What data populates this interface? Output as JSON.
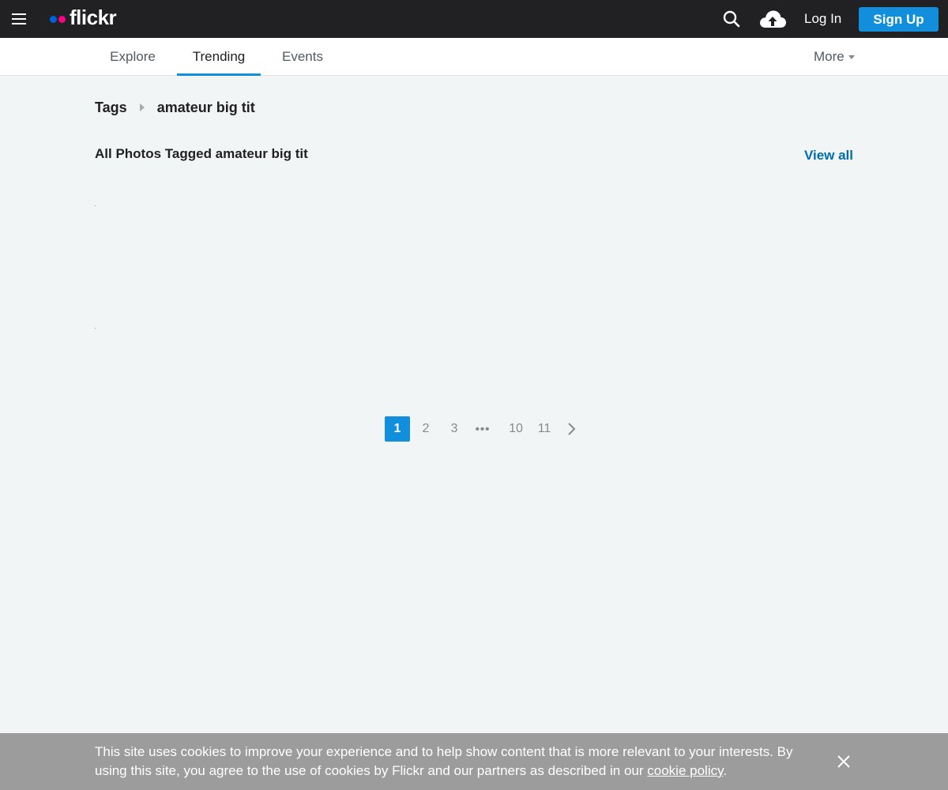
{
  "header": {
    "logo_text": "flickr",
    "logo_colors": {
      "blue": "#0063dc",
      "pink": "#ff0084"
    },
    "login_label": "Log In",
    "signup_label": "Sign Up",
    "icons": [
      "menu-icon",
      "search-icon",
      "upload-cloud-icon"
    ]
  },
  "subnav": {
    "tabs": [
      {
        "label": "Explore",
        "active": false
      },
      {
        "label": "Trending",
        "active": true
      },
      {
        "label": "Events",
        "active": false
      }
    ],
    "more_label": "More"
  },
  "breadcrumb": {
    "root": "Tags",
    "current": "amateur big tit"
  },
  "section": {
    "title": "All Photos Tagged amateur big tit",
    "view_all_label": "View all"
  },
  "pagination": {
    "pages": [
      "1",
      "2",
      "3"
    ],
    "ellipsis": "•••",
    "tail_pages": [
      "10",
      "11"
    ],
    "current": "1"
  },
  "cookie_banner": {
    "text_before": "This site uses cookies to improve your experience and to help show content that is more relevant to your interests. By using this site, you agree to the use of cookies by Flickr and our partners as described in our ",
    "link_text": "cookie policy",
    "text_after": "."
  },
  "colors": {
    "topbar": "#212124",
    "accent": "#128fdc",
    "link": "#006dac",
    "page_bg": "#f2f5f6",
    "cookie_bg": "#9c9c9c"
  }
}
